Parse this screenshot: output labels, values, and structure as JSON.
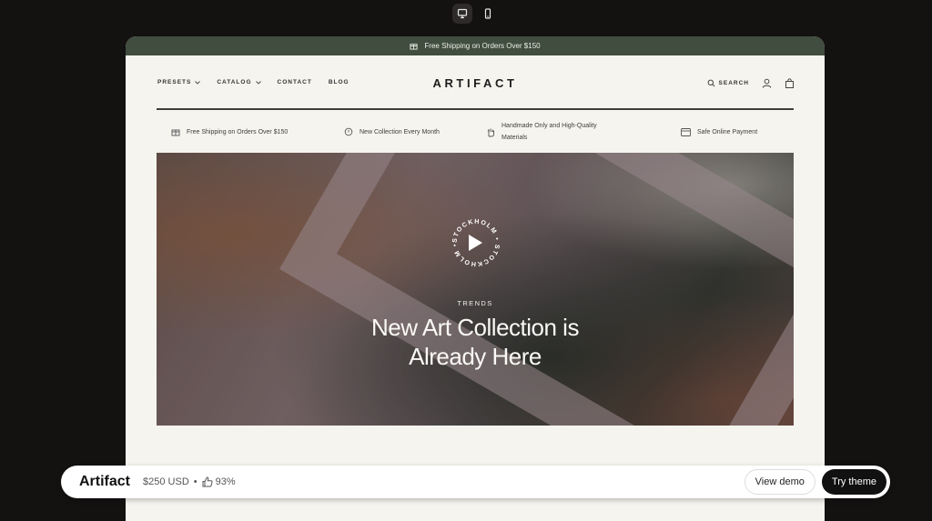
{
  "device_toggle": {
    "desktop_icon": "monitor-icon",
    "mobile_icon": "phone-icon"
  },
  "preview": {
    "announcement": {
      "icon": "gift-icon",
      "text": "Free Shipping on Orders Over $150"
    },
    "nav": [
      {
        "label": "PRESETS",
        "has_dropdown": true
      },
      {
        "label": "CATALOG",
        "has_dropdown": true
      },
      {
        "label": "CONTACT",
        "has_dropdown": false
      },
      {
        "label": "BLOG",
        "has_dropdown": false
      }
    ],
    "logo": "ARTIFACT",
    "search_label": "SEARCH",
    "features": [
      {
        "icon": "gift-icon",
        "text": "Free Shipping on Orders Over $150"
      },
      {
        "icon": "calendar-icon",
        "text": "New Collection Every Month"
      },
      {
        "icon": "hand-icon",
        "line1": "Handmade Only and High-Quality",
        "line2": "Materials"
      },
      {
        "icon": "credit-card-icon",
        "text": "Safe Online Payment"
      }
    ],
    "hero": {
      "badge_text": "STOCKHOLM • STOCKHOLM •",
      "eyebrow": "TRENDS",
      "headline_line1": "New Art Collection is",
      "headline_line2": "Already Here"
    }
  },
  "theme_bar": {
    "name": "Artifact",
    "price": "$250 USD",
    "separator": "•",
    "rating": "93%",
    "rating_icon": "thumbs-up-icon",
    "view_demo_label": "View demo",
    "try_theme_label": "Try theme"
  },
  "colors": {
    "page_bg": "#141111",
    "announcement_bg": "#414d3f",
    "store_bg": "#f5f4ee",
    "accent_dark": "#111111"
  }
}
